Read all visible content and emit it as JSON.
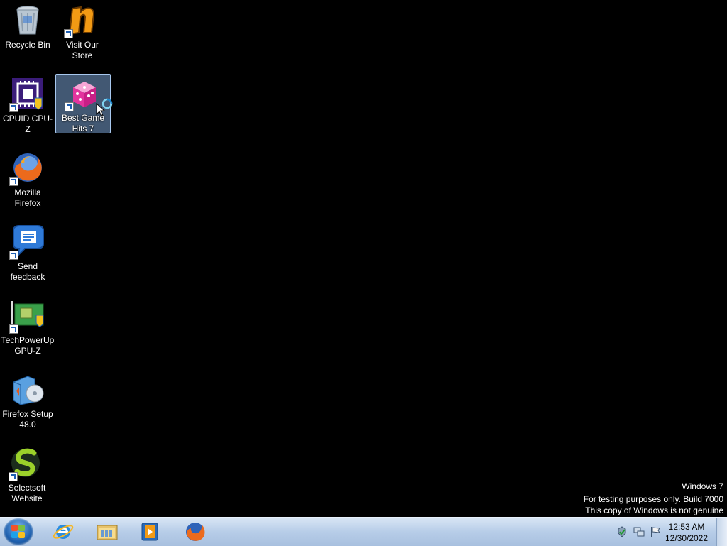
{
  "desktop_icons": [
    {
      "label_line1": "Recycle Bin",
      "label_line2": ""
    },
    {
      "label_line1": "Visit Our",
      "label_line2": "Store"
    },
    {
      "label_line1": "CPUID CPU-Z",
      "label_line2": ""
    },
    {
      "label_line1": "Best Game",
      "label_line2": "Hits 7"
    },
    {
      "label_line1": "Mozilla",
      "label_line2": "Firefox"
    },
    {
      "label_line1": "Send",
      "label_line2": "feedback"
    },
    {
      "label_line1": "TechPowerUp",
      "label_line2": "GPU-Z"
    },
    {
      "label_line1": "Firefox Setup",
      "label_line2": "48.0"
    },
    {
      "label_line1": "Selectsoft",
      "label_line2": "Website"
    }
  ],
  "watermark": {
    "line1": "Windows 7",
    "line2": "For testing purposes only. Build 7000",
    "line3": "This copy of Windows is not genuine"
  },
  "taskbar": {
    "pinned": [
      "internet-explorer-icon",
      "windows-explorer-icon",
      "media-player-icon",
      "firefox-icon"
    ],
    "clock_time": "12:53 AM",
    "clock_date": "12/30/2022"
  },
  "colors": {
    "desktop_bg": "#000000",
    "taskbar_bg": "#b7cde8",
    "selection": "#78a0d2"
  }
}
